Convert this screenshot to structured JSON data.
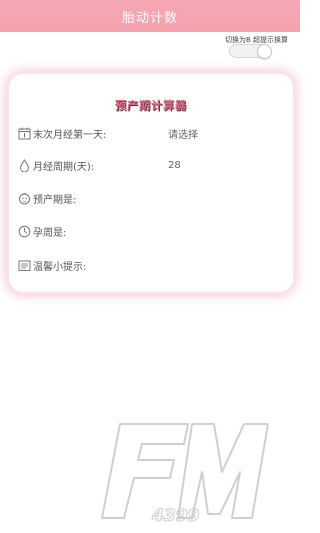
{
  "header": {
    "title": "胎动计数"
  },
  "toggle": {
    "label": "切换为B 超提示换算",
    "state": "off"
  },
  "calculator": {
    "title": "预产期计算器",
    "rows": [
      {
        "icon": "calendar-icon",
        "label": "末次月经第一天:",
        "value": "请选择"
      },
      {
        "icon": "drop-icon",
        "label": "月经周期(天):",
        "value": "28"
      },
      {
        "icon": "baby-face-icon",
        "label": "预产期是:",
        "value": ""
      },
      {
        "icon": "clock-icon",
        "label": "孕周是:",
        "value": ""
      },
      {
        "icon": "note-icon",
        "label": "温馨小提示:",
        "value": ""
      }
    ]
  },
  "watermark": {
    "big": "FM",
    "small": "4399"
  }
}
